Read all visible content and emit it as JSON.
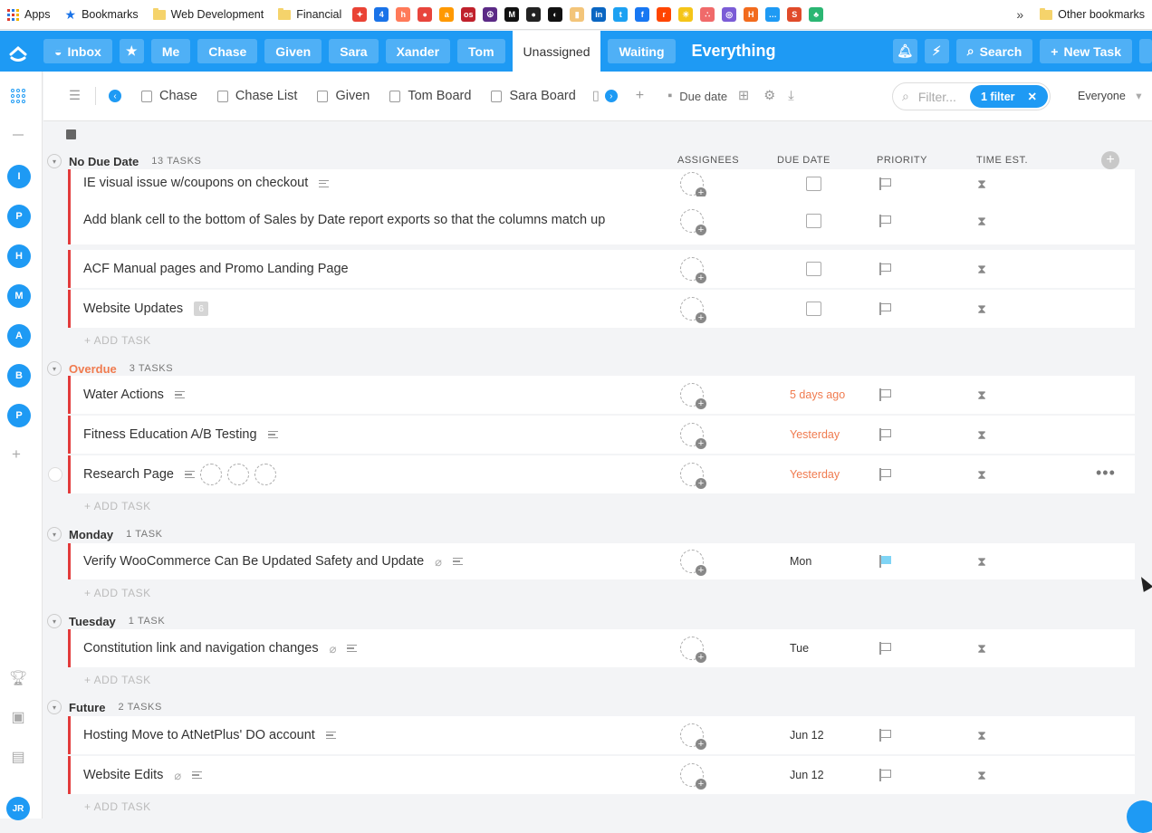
{
  "bookmarks": {
    "apps_label": "Apps",
    "bookmarks_label": "Bookmarks",
    "web_dev_label": "Web Development",
    "financial_label": "Financial",
    "favicons": [
      {
        "name": "picasa-icon",
        "color": "#ea4335",
        "glyph": "✦"
      },
      {
        "name": "calendar-icon",
        "color": "#1a73e8",
        "glyph": "4"
      },
      {
        "name": "hubspot-icon",
        "color": "#ff7a59",
        "glyph": "h"
      },
      {
        "name": "tomato-icon",
        "color": "#e8453c",
        "glyph": "●"
      },
      {
        "name": "amazon-icon",
        "color": "#ff9900",
        "glyph": "a"
      },
      {
        "name": "lastpass-icon",
        "color": "#c0212c",
        "glyph": "os"
      },
      {
        "name": "peace-icon",
        "color": "#5b2a86",
        "glyph": "☮"
      },
      {
        "name": "m-icon",
        "color": "#111111",
        "glyph": "M"
      },
      {
        "name": "ninja-icon",
        "color": "#222222",
        "glyph": "●"
      },
      {
        "name": "headphones-icon",
        "color": "#111111",
        "glyph": "◐"
      },
      {
        "name": "jar-icon",
        "color": "#f3c57a",
        "glyph": "▮"
      },
      {
        "name": "linkedin-icon",
        "color": "#0a66c2",
        "glyph": "in"
      },
      {
        "name": "twitter-icon",
        "color": "#1da1f2",
        "glyph": "t"
      },
      {
        "name": "facebook-icon",
        "color": "#1877f2",
        "glyph": "f"
      },
      {
        "name": "reddit-icon",
        "color": "#ff4500",
        "glyph": "r"
      },
      {
        "name": "idea-icon",
        "color": "#f5c518",
        "glyph": "☀"
      },
      {
        "name": "asana-icon",
        "color": "#f06a6a",
        "glyph": "∴"
      },
      {
        "name": "circle-icon",
        "color": "#7b5cd6",
        "glyph": "◎"
      },
      {
        "name": "h-icon",
        "color": "#f26b1d",
        "glyph": "H"
      },
      {
        "name": "chat-icon",
        "color": "#1e9af4",
        "glyph": "…"
      },
      {
        "name": "s-icon",
        "color": "#e04b2a",
        "glyph": "S"
      },
      {
        "name": "leaf-icon",
        "color": "#2bb673",
        "glyph": "♣"
      }
    ],
    "more_label": "»",
    "other_label": "Other bookmarks"
  },
  "topbar": {
    "inbox_label": "Inbox",
    "tabs": [
      "Me",
      "Chase",
      "Given",
      "Sara",
      "Xander",
      "Tom"
    ],
    "active_tab": "Unassigned",
    "waiting_label": "Waiting",
    "title": "Everything",
    "search_label": "Search",
    "new_task_label": "New Task"
  },
  "rail": {
    "avatars": [
      "I",
      "P",
      "H",
      "M",
      "A",
      "B",
      "P"
    ],
    "me_initials": "JR"
  },
  "viewbar": {
    "views": [
      "Chase",
      "Chase List",
      "Given",
      "Tom Board",
      "Sara Board"
    ],
    "due_date_label": "Due date",
    "filter_placeholder": "Filter...",
    "filter_pill_label": "1 filter",
    "everyone_label": "Everyone"
  },
  "columns": {
    "assignees": "ASSIGNEES",
    "due_date": "DUE DATE",
    "priority": "PRIORITY",
    "time_est": "TIME EST."
  },
  "add_task_label": "+ ADD TASK",
  "groups": [
    {
      "name": "No Due Date",
      "count": "13 TASKS",
      "overdue": false,
      "tasks": [
        {
          "name": "IE visual issue w/coupons on checkout",
          "due": "",
          "desc": true
        },
        {
          "name": "Add blank cell to the bottom of Sales by Date report exports so that the columns match up",
          "due": "",
          "desc": false
        },
        {
          "name": "ACF Manual pages and Promo Landing Page",
          "due": "",
          "desc": false
        },
        {
          "name": "Website Updates",
          "due": "",
          "desc": false,
          "subtasks": "6"
        }
      ]
    },
    {
      "name": "Overdue",
      "count": "3 TASKS",
      "overdue": true,
      "tasks": [
        {
          "name": "Water Actions",
          "due": "5 days ago",
          "desc": true
        },
        {
          "name": "Fitness Education A/B Testing",
          "due": "Yesterday",
          "desc": true
        },
        {
          "name": "Research Page",
          "due": "Yesterday",
          "desc": true
        }
      ]
    },
    {
      "name": "Monday",
      "count": "1 TASK",
      "overdue": false,
      "tasks": [
        {
          "name": "Verify WooCommerce Can Be Updated Safety and Update",
          "due": "Mon",
          "desc": true
        }
      ]
    },
    {
      "name": "Tuesday",
      "count": "1 TASK",
      "overdue": false,
      "tasks": [
        {
          "name": "Constitution link and navigation changes",
          "due": "Tue",
          "desc": true
        }
      ]
    },
    {
      "name": "Future",
      "count": "2 TASKS",
      "overdue": false,
      "tasks": [
        {
          "name": "Hosting Move to AtNetPlus' DO account",
          "due": "Jun 12",
          "desc": true
        },
        {
          "name": "Website Edits",
          "due": "Jun 12",
          "desc": true
        }
      ]
    }
  ],
  "colors": {
    "brand": "#1e9af4",
    "overdue": "#f07b4f",
    "task_border": "#e23b3b",
    "priority_blue": "#7fd4f5"
  }
}
